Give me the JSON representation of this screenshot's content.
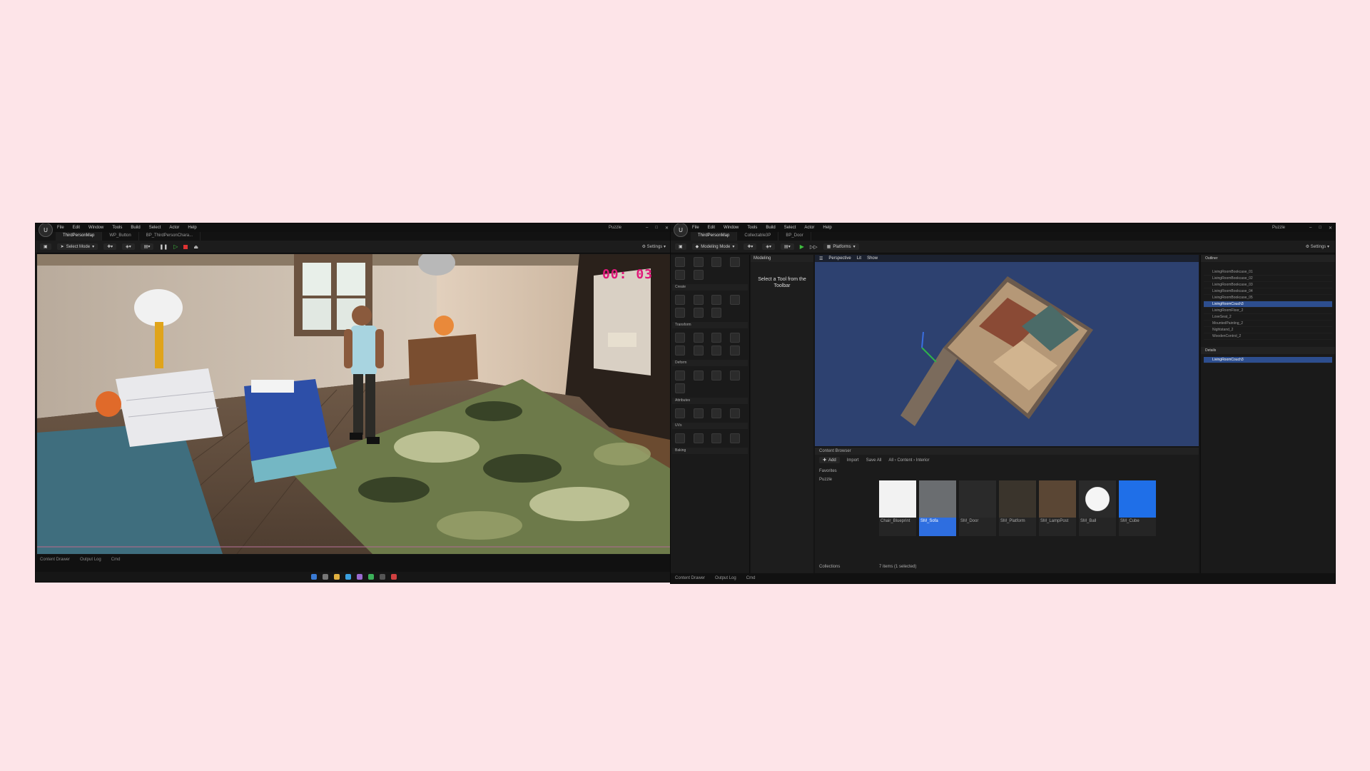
{
  "left_window": {
    "menu": [
      "File",
      "Edit",
      "Window",
      "Tools",
      "Build",
      "Select",
      "Actor",
      "Help"
    ],
    "project_name": "Puzzle",
    "tabs": [
      "ThirdPersonMap",
      "WP_Button",
      "BP_ThirdPersonChara..."
    ],
    "select_mode_label": "Select Mode",
    "settings_label": "Settings",
    "timer_text": "00: 03",
    "bottom_left_label": "Content Drawer",
    "output_log_label": "Output Log",
    "cmd_label": "Cmd"
  },
  "right_window": {
    "menu": [
      "File",
      "Edit",
      "Window",
      "Tools",
      "Build",
      "Select",
      "Actor",
      "Help"
    ],
    "project_name": "Puzzle",
    "tabs": [
      "ThirdPersonMap",
      "Collectable3P",
      "BP_Door"
    ],
    "mode_label": "Modeling Mode",
    "platforms_label": "Platforms",
    "settings_label": "Settings",
    "modeling_panel_title": "Modeling",
    "modeling_hint": "Select a Tool from the Toolbar",
    "mode_sections": [
      "Create",
      "Transform",
      "Deform",
      "Attributes",
      "UVs",
      "Baking"
    ],
    "viewport_tabs": [
      "Perspective",
      "Lit",
      "Show"
    ],
    "outliner_title": "Outliner",
    "outliner_rows": [
      "LivingRoomBookcase_01",
      "LivingRoomBookcase_02",
      "LivingRoomBookcase_03",
      "LivingRoomBookcase_04",
      "LivingRoomBookcase_05",
      "LivingRoomCouch3",
      "LivingRoomFloor_2",
      "LoveSeat_2",
      "MountedPainting_2",
      "Nightstand_2",
      "WoodenControl_2"
    ],
    "details_title": "Details",
    "details_selected": "LivingRoomCouch3",
    "content_browser_title": "Content Browser",
    "cb_add_label": "Add",
    "cb_import_label": "Import",
    "cb_save_all_label": "Save All",
    "cb_path": [
      "All",
      "Content",
      "Interior"
    ],
    "cb_favorites": "Favorites",
    "cb_project": "Puzzle",
    "cb_collections": "Collections",
    "cb_item_count": "7 items (1 selected)",
    "assets": [
      "Chair_Blueprint",
      "SM_Sofa",
      "SM_Door",
      "SM_Platform",
      "SM_LampPost",
      "SM_Ball",
      "SM_Cube"
    ],
    "statusbar": [
      "Content Drawer",
      "Output Log",
      "Cmd"
    ]
  }
}
